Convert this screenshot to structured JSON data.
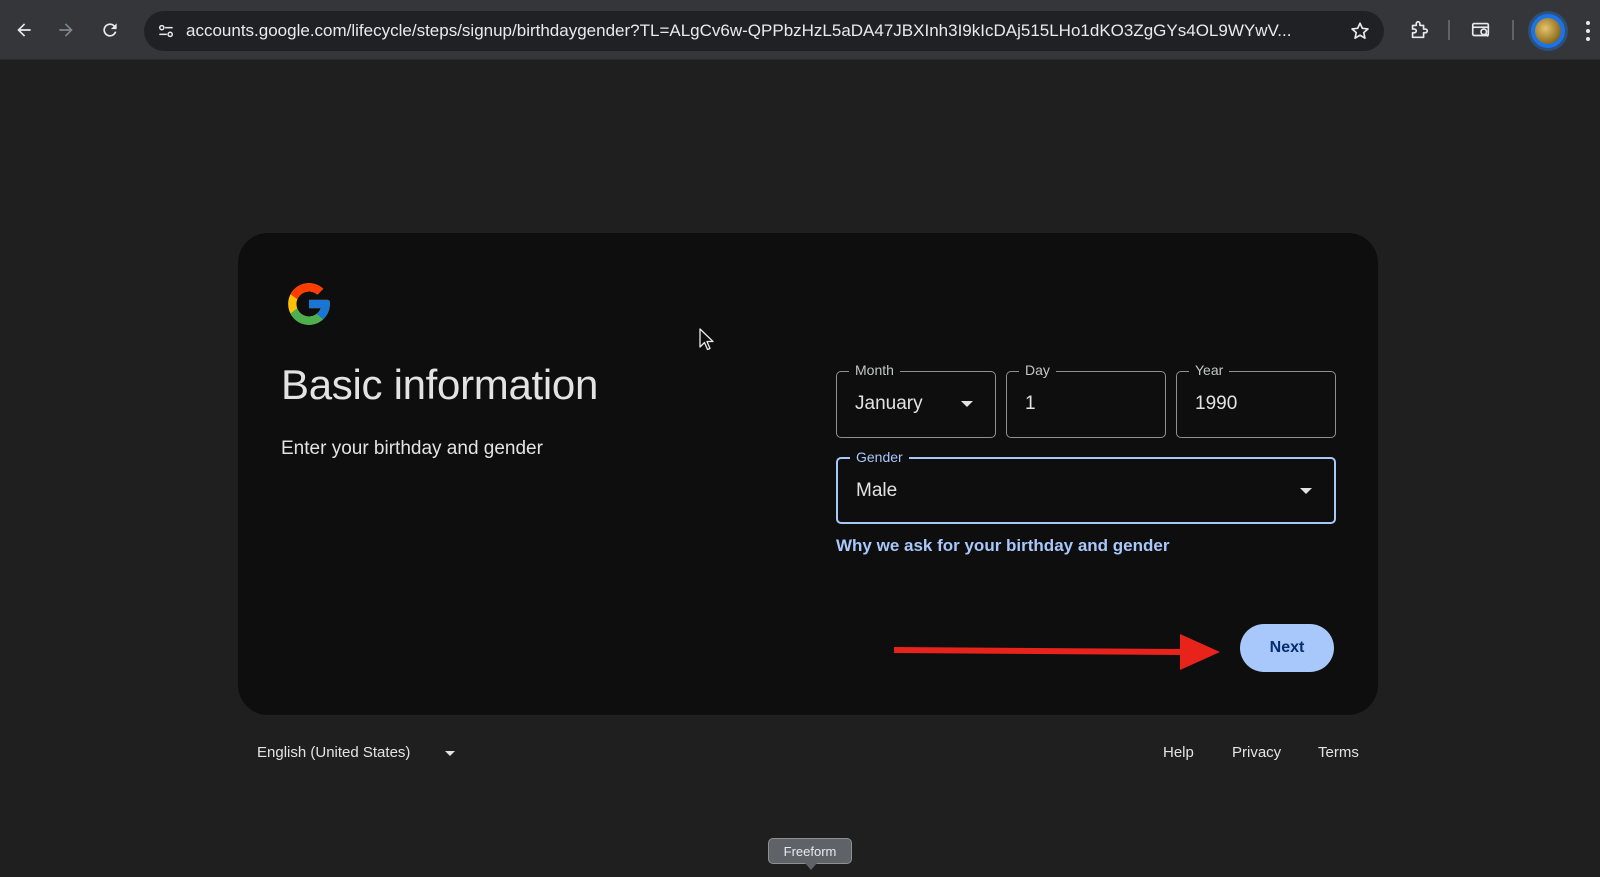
{
  "browser": {
    "url": "accounts.google.com/lifecycle/steps/signup/birthdaygender?TL=ALgCv6w-QPPbzHzL5aDA47JBXInh3I9kIcDAj515LHo1dKO3ZgGYs4OL9WYwV...",
    "icons": [
      "back-arrow-icon",
      "forward-arrow-icon",
      "reload-icon",
      "site-settings-icon",
      "star-icon",
      "extensions-icon",
      "tab-search-icon",
      "profile-avatar",
      "more-menu-icon"
    ]
  },
  "form": {
    "title": "Basic information",
    "subtitle": "Enter your birthday and gender",
    "month": {
      "label": "Month",
      "value": "January"
    },
    "day": {
      "label": "Day",
      "value": "1"
    },
    "year": {
      "label": "Year",
      "value": "1990"
    },
    "gender": {
      "label": "Gender",
      "value": "Male"
    },
    "why_link": "Why we ask for your birthday and gender",
    "next_label": "Next"
  },
  "footer": {
    "language": "English (United States)",
    "help": "Help",
    "privacy": "Privacy",
    "terms": "Terms"
  },
  "tooltip": "Freeform",
  "colors": {
    "accent": "#a8c7fa",
    "annotation_arrow": "#e8231b"
  }
}
